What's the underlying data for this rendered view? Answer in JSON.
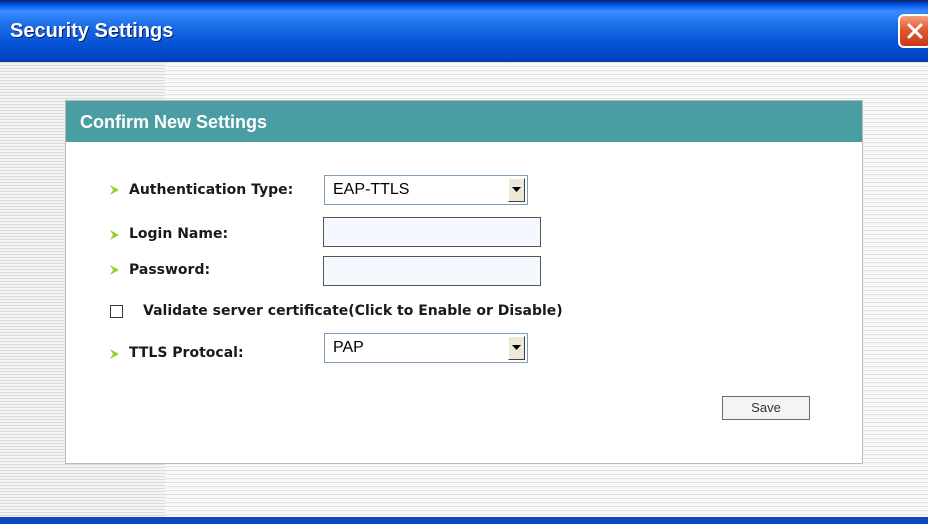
{
  "window": {
    "title": "Security Settings",
    "close_icon": "close-icon"
  },
  "panel": {
    "title": "Confirm New Settings"
  },
  "form": {
    "auth_type": {
      "label": "Authentication Type:",
      "value": "EAP-TTLS"
    },
    "login_name": {
      "label": "Login Name:",
      "value": ""
    },
    "password": {
      "label": "Password:",
      "value": ""
    },
    "validate_cert": {
      "label": "Validate server certificate(Click to Enable or Disable)",
      "checked": false
    },
    "ttls_protocol": {
      "label": "TTLS Protocal:",
      "value": "PAP"
    },
    "save_label": "Save"
  },
  "colors": {
    "titlebar": "#0653d6",
    "panel_header": "#4a9da2",
    "bullet": "#9acd32"
  }
}
